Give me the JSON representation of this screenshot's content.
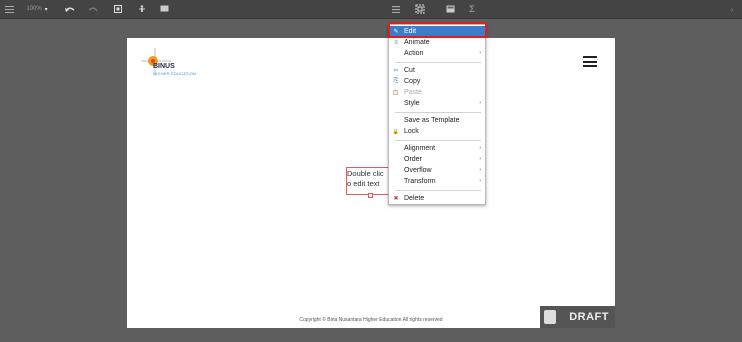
{
  "toolbar": {
    "zoom": "100%",
    "zoom_caret": "▾"
  },
  "canvas": {
    "logo": {
      "name": "BINUS",
      "subtitle": "HIGHER EDUCATION"
    },
    "textbox_lines": [
      "Double clic",
      "o edit text"
    ],
    "footer": "Copyright © Bina Nusantara Higher Education All rights reserved",
    "draft_label": "DRAFT"
  },
  "context_menu": {
    "items": [
      {
        "label": "Edit",
        "icon": "✎",
        "arrow": ""
      },
      {
        "label": "Animate",
        "icon": "≡",
        "arrow": ""
      },
      {
        "label": "Action",
        "icon": "",
        "arrow": "›"
      },
      {
        "label": "Cut",
        "icon": "✂",
        "arrow": ""
      },
      {
        "label": "Copy",
        "icon": "⎘",
        "arrow": ""
      },
      {
        "label": "Paste",
        "icon": "📋",
        "arrow": ""
      },
      {
        "label": "Style",
        "icon": "",
        "arrow": "›"
      },
      {
        "label": "Save as Template",
        "icon": "",
        "arrow": ""
      },
      {
        "label": "Lock",
        "icon": "🔒",
        "arrow": ""
      },
      {
        "label": "Alignment",
        "icon": "",
        "arrow": "›"
      },
      {
        "label": "Order",
        "icon": "",
        "arrow": "›"
      },
      {
        "label": "Overflow",
        "icon": "",
        "arrow": "›"
      },
      {
        "label": "Transform",
        "icon": "",
        "arrow": "›"
      },
      {
        "label": "Delete",
        "icon": "✖",
        "arrow": ""
      }
    ]
  },
  "colors": {
    "menu_active": "#3d7cc9",
    "highlight": "#e11d1d"
  }
}
